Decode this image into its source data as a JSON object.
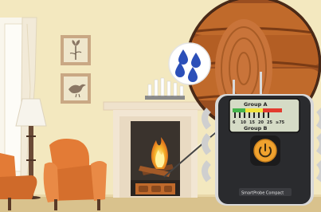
{
  "meter": {
    "lcd_group_a": "Group A",
    "lcd_group_b": "Group B",
    "scale_ticks": [
      "6",
      "10",
      "15",
      "20",
      "25",
      "≥75"
    ],
    "brand": "SmartProbe Compact",
    "power_icon": "power-icon"
  },
  "bubble": {
    "icon": "water-drops-icon"
  },
  "colors": {
    "wall": "#f3e8bf",
    "armchair": "#e37b36",
    "fireplace": "#f2e6d3",
    "meter_body": "#2a2b2e",
    "meter_accent": "#f0a22e",
    "drop_blue": "#2b4fb8",
    "wood": "#c06a2b"
  }
}
